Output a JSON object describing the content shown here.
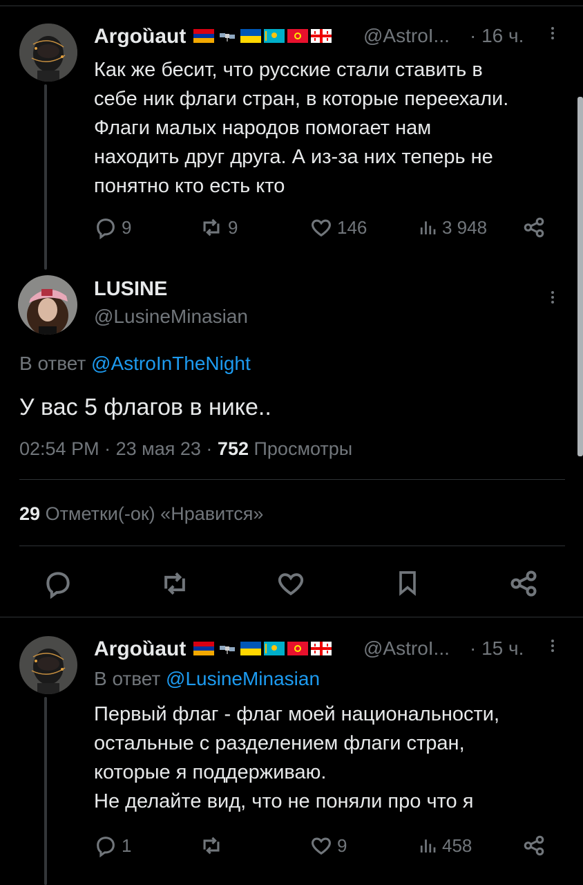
{
  "colors": {
    "background": "#000000",
    "text": "#e7e9ea",
    "secondary": "#71767b",
    "link": "#1d9bf0",
    "divider": "#2f3336"
  },
  "tweet1": {
    "author_name": "Argoȕaut",
    "handle": "@AstroI...",
    "time": "· 16 ч.",
    "flags": [
      "armenia-flag",
      "satellite-icon",
      "ukraine-flag",
      "kazakhstan-flag",
      "kyrgyzstan-flag",
      "georgia-flag"
    ],
    "lines": [
      "Как же бесит, что русские стали ставить в",
      "себе ник флаги стран, в которые переехали.",
      "Флаги малых народов помогает нам",
      "находить друг друга. А из-за них теперь не",
      "понятно кто есть кто"
    ],
    "replies": "9",
    "retweets": "9",
    "likes": "146",
    "views": "3 948"
  },
  "main_tweet": {
    "author_name": "LUSINE",
    "handle": "@LusineMinasian",
    "reply_prefix": "В ответ",
    "reply_to": "@AstroInTheNight",
    "text": "У вас 5 флагов в нике..",
    "time": "02:54 PM",
    "date": "23 мая 23",
    "views_count": "752",
    "views_label": "Просмотры",
    "sep": "·",
    "likes_count": "29",
    "likes_label": "Отметки(-ок) «Нравится»"
  },
  "tweet2": {
    "author_name": "Argoȕaut",
    "handle": "@AstroI...",
    "time": "· 15 ч.",
    "reply_prefix": "В ответ",
    "reply_to": "@LusineMinasian",
    "lines": [
      "Первый флаг - флаг моей национальности,",
      "остальные с разделением флаги стран,",
      "которые я поддерживаю.",
      "Не делайте вид, что не поняли про что я"
    ],
    "replies": "1",
    "retweets": "",
    "likes": "9",
    "views": "458"
  }
}
